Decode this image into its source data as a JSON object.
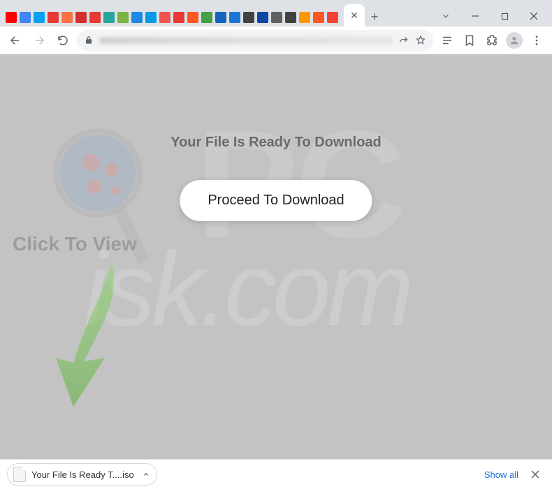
{
  "page": {
    "headline": "Your File Is Ready To Download",
    "proceed_label": "Proceed To Download",
    "click_to_view": "Click To View"
  },
  "download_bar": {
    "filename": "Your File Is Ready T....iso",
    "show_all_label": "Show all"
  },
  "extension_icons": [
    {
      "name": "youtube",
      "color": "#ff0000"
    },
    {
      "name": "google",
      "color": "#4285f4"
    },
    {
      "name": "cloud-dl",
      "color": "#00a1f1"
    },
    {
      "name": "dl-red",
      "color": "#e53935"
    },
    {
      "name": "cloud2",
      "color": "#ff7043"
    },
    {
      "name": "play",
      "color": "#d32f2f"
    },
    {
      "name": "dl-red2",
      "color": "#e53935"
    },
    {
      "name": "music",
      "color": "#26a69a"
    },
    {
      "name": "note",
      "color": "#7cb342"
    },
    {
      "name": "doc",
      "color": "#1e88e5"
    },
    {
      "name": "code",
      "color": "#039be5"
    },
    {
      "name": "audio",
      "color": "#ef5350"
    },
    {
      "name": "rec",
      "color": "#e53935"
    },
    {
      "name": "dl3",
      "color": "#ff5722"
    },
    {
      "name": "play2",
      "color": "#43a047"
    },
    {
      "name": "tv",
      "color": "#1565c0"
    },
    {
      "name": "l",
      "color": "#1976d2"
    },
    {
      "name": "disc",
      "color": "#424242"
    },
    {
      "name": "eq",
      "color": "#0d47a1"
    },
    {
      "name": "globe",
      "color": "#616161"
    },
    {
      "name": "play3",
      "color": "#424242"
    },
    {
      "name": "wave",
      "color": "#ff9800"
    },
    {
      "name": "sc",
      "color": "#ff5722"
    },
    {
      "name": "dl4",
      "color": "#f44336"
    }
  ],
  "watermark": {
    "pc": "PC",
    "risk": "isk.com"
  }
}
